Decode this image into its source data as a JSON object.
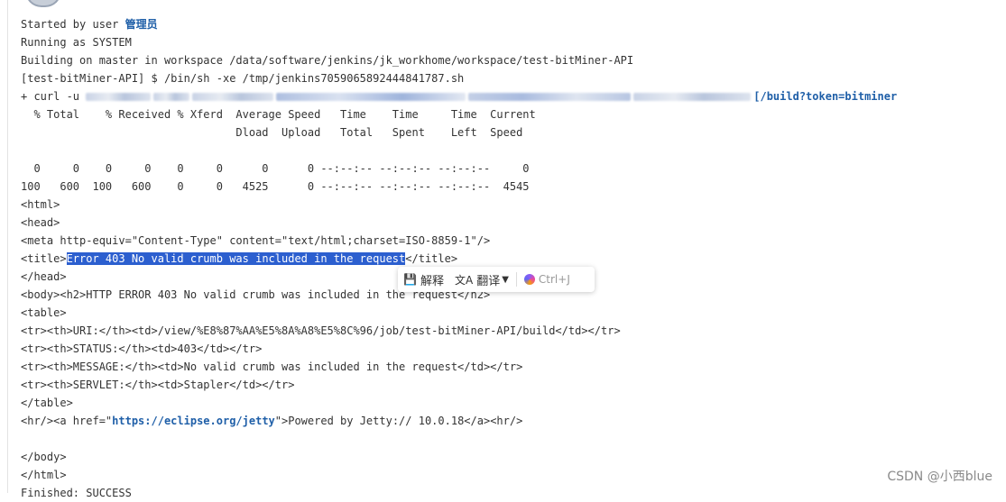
{
  "console": {
    "started_prefix": "Started by user ",
    "started_user": "管理员",
    "running_as": "Running as SYSTEM",
    "building": "Building on master in workspace /data/software/jenkins/jk_workhome/workspace/test-bitMiner-API",
    "shell_cmd": "[test-bitMiner-API] $ /bin/sh -xe /tmp/jenkins7059065892444841787.sh",
    "curl_prefix": "+ curl -u ",
    "curl_url_tail": "[/build?token=bitminer",
    "header1": "  % Total    % Received % Xferd  Average Speed   Time    Time     Time  Current",
    "header2": "                                 Dload  Upload   Total   Spent    Left  Speed",
    "blank1": " ",
    "progress1": "  0     0    0     0    0     0      0      0 --:--:-- --:--:-- --:--:--     0",
    "progress2": "100   600  100   600    0     0   4525      0 --:--:-- --:--:-- --:--:--  4545",
    "html_open": "<html>",
    "head_open": "<head>",
    "meta": "<meta http-equiv=\"Content-Type\" content=\"text/html;charset=ISO-8859-1\"/>",
    "title_open": "<title>",
    "title_text": "Error 403 No valid crumb was included in the request",
    "title_close": "</title>",
    "head_close": "</head>",
    "body_h2": "<body><h2>HTTP ERROR 403 No valid crumb was included in the request</h2>",
    "table_open": "<table>",
    "row_uri": "<tr><th>URI:</th><td>/view/%E8%87%AA%E5%8A%A8%E5%8C%96/job/test-bitMiner-API/build</td></tr>",
    "row_status": "<tr><th>STATUS:</th><td>403</td></tr>",
    "row_message": "<tr><th>MESSAGE:</th><td>No valid crumb was included in the request</td></tr>",
    "row_servlet": "<tr><th>SERVLET:</th><td>Stapler</td></tr>",
    "table_close": "</table>",
    "hr_prefix": "<hr/><a href=\"",
    "hr_link": "https://eclipse.org/jetty",
    "hr_suffix": "\">Powered by Jetty:// 10.0.18</a><hr/>",
    "blank2": " ",
    "body_close": "</body>",
    "html_close": "</html>",
    "finished": "Finished: SUCCESS"
  },
  "selection_toolbar": {
    "explain_label": "解释",
    "translate_label": "翻译",
    "shortcut_label": "Ctrl+J"
  },
  "watermark": "CSDN @小西blue"
}
